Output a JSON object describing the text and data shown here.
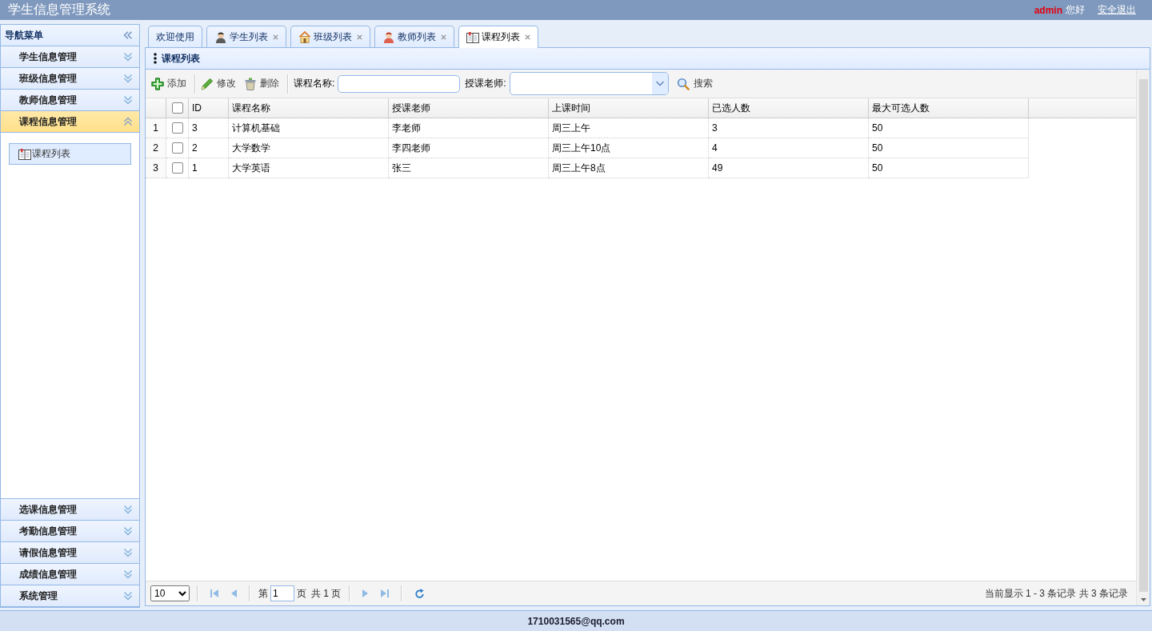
{
  "header": {
    "title": "学生信息管理系统",
    "user": "admin",
    "greeting": "您好",
    "logout": "安全退出"
  },
  "sidebar": {
    "title": "导航菜单",
    "sections": [
      {
        "label": "学生信息管理",
        "expanded": false
      },
      {
        "label": "班级信息管理",
        "expanded": false
      },
      {
        "label": "教师信息管理",
        "expanded": false
      },
      {
        "label": "课程信息管理",
        "expanded": true,
        "items": [
          {
            "label": "课程列表"
          }
        ]
      },
      {
        "label": "选课信息管理",
        "expanded": false
      },
      {
        "label": "考勤信息管理",
        "expanded": false
      },
      {
        "label": "请假信息管理",
        "expanded": false
      },
      {
        "label": "成绩信息管理",
        "expanded": false
      },
      {
        "label": "系统管理",
        "expanded": false
      }
    ]
  },
  "tabs": [
    {
      "label": "欢迎使用",
      "kind": "welcome",
      "closable": false,
      "selected": false
    },
    {
      "label": "学生列表",
      "kind": "student",
      "closable": true,
      "selected": false
    },
    {
      "label": "班级列表",
      "kind": "class",
      "closable": true,
      "selected": false
    },
    {
      "label": "教师列表",
      "kind": "teacher",
      "closable": true,
      "selected": false
    },
    {
      "label": "课程列表",
      "kind": "course",
      "closable": true,
      "selected": true
    }
  ],
  "panel": {
    "title": "课程列表"
  },
  "toolbar": {
    "buttons": [
      {
        "label": "添加",
        "kind": "add"
      },
      {
        "label": "修改",
        "kind": "edit"
      },
      {
        "label": "删除",
        "kind": "delete"
      }
    ],
    "name_field": {
      "label": "课程名称:"
    },
    "teacher_field": {
      "label": "授课老师:"
    },
    "search": {
      "label": "搜索"
    }
  },
  "table": {
    "columns": [
      "ID",
      "课程名称",
      "授课老师",
      "上课时间",
      "已选人数",
      "最大可选人数"
    ],
    "all_checked": false,
    "rows": [
      {
        "number": "1",
        "checked": false,
        "cells": [
          "3",
          "计算机基础",
          "李老师",
          "周三上午",
          "3",
          "50"
        ]
      },
      {
        "number": "2",
        "checked": false,
        "cells": [
          "2",
          "大学数学",
          "李四老师",
          "周三上午10点",
          "4",
          "50"
        ]
      },
      {
        "number": "3",
        "checked": false,
        "cells": [
          "1",
          "大学英语",
          "张三",
          "周三上午8点",
          "49",
          "50"
        ]
      }
    ]
  },
  "pagination": {
    "page_size": "10",
    "page_prefix": "第",
    "page": "1",
    "page_suffix": "页",
    "total_pages": "共 1 页",
    "nav_disabled": true,
    "info": "当前显示 1 - 3 条记录 共 3 条记录"
  },
  "footer": {
    "text": "1710031565@qq.com"
  }
}
